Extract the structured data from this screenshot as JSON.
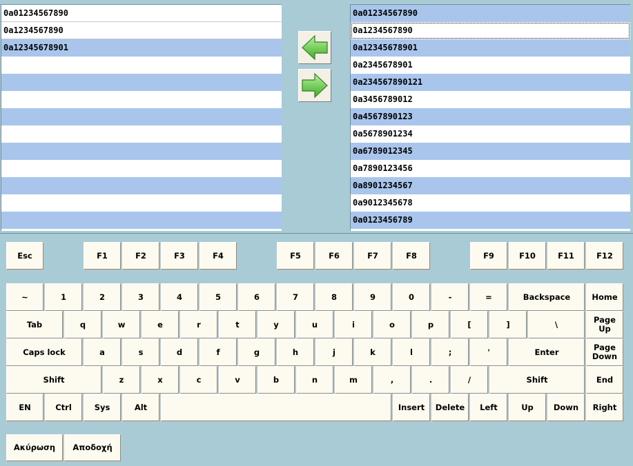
{
  "left_list": {
    "items": [
      "0a01234567890",
      "0a1234567890",
      "0a12345678901"
    ],
    "selected_index": 2,
    "visible_rows": 13
  },
  "right_list": {
    "items": [
      "0a01234567890",
      "0a1234567890",
      "0a12345678901",
      "0a2345678901",
      "0a234567890121",
      "0a3456789012",
      "0a4567890123",
      "0a5678901234",
      "0a6789012345",
      "0a7890123456",
      "0a8901234567",
      "0a9012345678",
      "0a0123456789"
    ],
    "focused_index": 1
  },
  "arrows": {
    "left": "arrow-left-icon",
    "right": "arrow-right-icon",
    "color": "#5cc83a"
  },
  "keyboard": {
    "rows": [
      [
        [
          "Esc",
          "key-esc"
        ],
        [
          "F1",
          "key-f1"
        ],
        [
          "F2",
          "key-f2"
        ],
        [
          "F3",
          "key-f3"
        ],
        [
          "F4",
          "key-f4"
        ],
        [
          "F5",
          "key-f5"
        ],
        [
          "F6",
          "key-f6"
        ],
        [
          "F7",
          "key-f7"
        ],
        [
          "F8",
          "key-f8"
        ],
        [
          "F9",
          "key-f9"
        ],
        [
          "F10",
          "key-f10"
        ],
        [
          "F11",
          "key-f11"
        ],
        [
          "F12",
          "key-f12"
        ]
      ],
      [
        [
          "~",
          "key-tilde"
        ],
        [
          "1",
          "key-1"
        ],
        [
          "2",
          "key-2"
        ],
        [
          "3",
          "key-3"
        ],
        [
          "4",
          "key-4"
        ],
        [
          "5",
          "key-5"
        ],
        [
          "6",
          "key-6"
        ],
        [
          "7",
          "key-7"
        ],
        [
          "8",
          "key-8"
        ],
        [
          "9",
          "key-9"
        ],
        [
          "0",
          "key-0"
        ],
        [
          "-",
          "key-minus"
        ],
        [
          "=",
          "key-equals"
        ],
        [
          "Backspace",
          "key-backspace"
        ],
        [
          "Home",
          "key-home"
        ]
      ],
      [
        [
          "Tab",
          "key-tab"
        ],
        [
          "q",
          "key-q"
        ],
        [
          "w",
          "key-w"
        ],
        [
          "e",
          "key-e"
        ],
        [
          "r",
          "key-r"
        ],
        [
          "t",
          "key-t"
        ],
        [
          "y",
          "key-y"
        ],
        [
          "u",
          "key-u"
        ],
        [
          "i",
          "key-i"
        ],
        [
          "o",
          "key-o"
        ],
        [
          "p",
          "key-p"
        ],
        [
          "[",
          "key-lbracket"
        ],
        [
          "]",
          "key-rbracket"
        ],
        [
          "\\",
          "key-backslash"
        ],
        [
          "Page Up",
          "key-page-up"
        ]
      ],
      [
        [
          "Caps lock",
          "key-caps-lock"
        ],
        [
          "a",
          "key-a"
        ],
        [
          "s",
          "key-s"
        ],
        [
          "d",
          "key-d"
        ],
        [
          "f",
          "key-f"
        ],
        [
          "g",
          "key-g"
        ],
        [
          "h",
          "key-h"
        ],
        [
          "j",
          "key-j"
        ],
        [
          "k",
          "key-k"
        ],
        [
          "l",
          "key-l"
        ],
        [
          ";",
          "key-semicolon"
        ],
        [
          "'",
          "key-quote"
        ],
        [
          "Enter",
          "key-enter"
        ],
        [
          "Page\nDown",
          "key-page-down"
        ]
      ],
      [
        [
          "Shift",
          "key-shift-left"
        ],
        [
          "z",
          "key-z"
        ],
        [
          "x",
          "key-x"
        ],
        [
          "c",
          "key-c"
        ],
        [
          "v",
          "key-v"
        ],
        [
          "b",
          "key-b"
        ],
        [
          "n",
          "key-n"
        ],
        [
          "m",
          "key-m"
        ],
        [
          ",",
          "key-comma"
        ],
        [
          ".",
          "key-period"
        ],
        [
          "/",
          "key-slash"
        ],
        [
          "Shift",
          "key-shift-right"
        ],
        [
          "End",
          "key-end"
        ]
      ],
      [
        [
          "EN",
          "key-en"
        ],
        [
          "Ctrl",
          "key-ctrl"
        ],
        [
          "Sys",
          "key-sys"
        ],
        [
          "Alt",
          "key-alt"
        ],
        [
          "",
          "key-space"
        ],
        [
          "Insert",
          "key-insert"
        ],
        [
          "Delete",
          "key-delete"
        ],
        [
          "Left",
          "key-left"
        ],
        [
          "Up",
          "key-up"
        ],
        [
          "Down",
          "key-down"
        ],
        [
          "Right",
          "key-right"
        ]
      ]
    ]
  },
  "actions": {
    "cancel": "Ακύρωση",
    "accept": "Αποδοχή"
  }
}
